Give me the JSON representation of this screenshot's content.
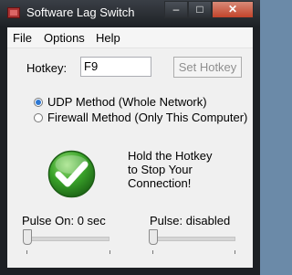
{
  "window": {
    "title": "Software Lag Switch"
  },
  "menu": {
    "file": "File",
    "options": "Options",
    "help": "Help"
  },
  "hotkey": {
    "label": "Hotkey:",
    "value": "F9",
    "set_button": "Set Hotkey"
  },
  "methods": {
    "udp": {
      "label": "UDP Method (Whole Network)",
      "selected": true
    },
    "firewall": {
      "label": "Firewall Method (Only This Computer)",
      "selected": false
    }
  },
  "status": {
    "icon": "green-checkmark-icon",
    "line1": "Hold the Hotkey",
    "line2": "to Stop Your",
    "line3": "Connection!"
  },
  "pulse_on": {
    "label": "Pulse On: 0 sec",
    "value": 0
  },
  "pulse": {
    "label": "Pulse: disabled",
    "value": 0
  }
}
